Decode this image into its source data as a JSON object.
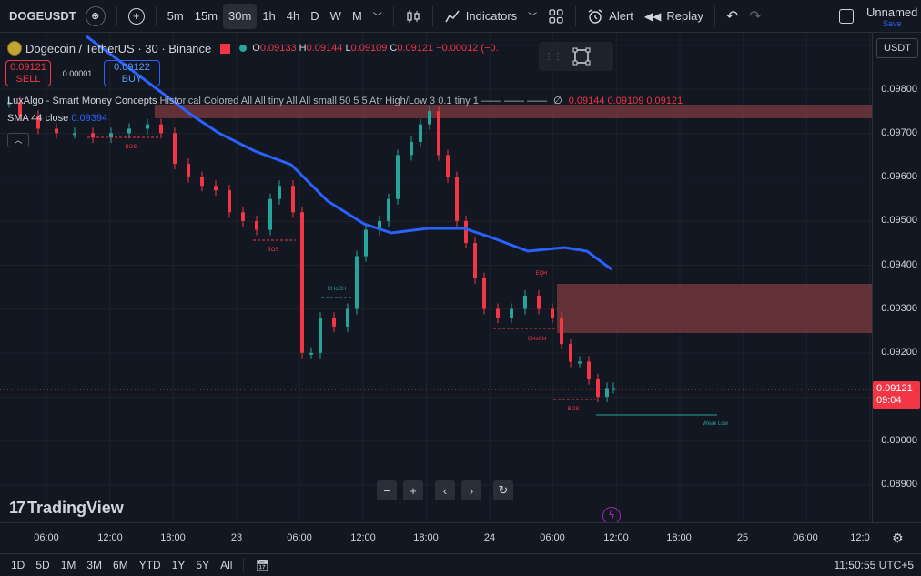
{
  "toolbar": {
    "symbol": "DOGEUSDT",
    "intervals": [
      "5m",
      "15m",
      "30m",
      "1h",
      "4h",
      "D",
      "W",
      "M"
    ],
    "active_interval": "30m",
    "indicators_label": "Indicators",
    "alert_label": "Alert",
    "replay_label": "Replay",
    "workspace_name": "Unnamed",
    "workspace_status": "Save"
  },
  "legend": {
    "title": "Dogecoin / TetherUS · 30 · Binance",
    "o_label": "O",
    "o": "0.09133",
    "h_label": "H",
    "h": "0.09144",
    "l_label": "L",
    "l": "0.09109",
    "c_label": "C",
    "c": "0.09121",
    "change": "−0.00012 (−0.",
    "sell_price": "0.09121",
    "sell_label": "SELL",
    "spread": "0.00001",
    "buy_price": "0.09122",
    "buy_label": "BUY",
    "smc_name": "LuxAlgo - Smart Money Concepts",
    "smc_params": "Historical Colored All All tiny All All small 50 5 5 Atr High/Low 3 0.1 tiny 1 —— —— ——",
    "smc_values": "0.09144  0.09109  0.09121",
    "sma_name": "SMA 44 close",
    "sma_value": "0.09394"
  },
  "price_axis": {
    "currency": "USDT",
    "labels": [
      "0.09800",
      "0.09700",
      "0.09600",
      "0.09500",
      "0.09400",
      "0.09300",
      "0.09200",
      "0.09000",
      "0.08900"
    ],
    "current_price": "0.09121",
    "countdown": "09:04"
  },
  "time_axis": {
    "labels": [
      "06:00",
      "12:00",
      "18:00",
      "23",
      "06:00",
      "12:00",
      "18:00",
      "24",
      "06:00",
      "12:00",
      "18:00",
      "25",
      "06:00",
      "12:0"
    ]
  },
  "annotations": {
    "bos": "BOS",
    "choch": "CHoCH",
    "eqh": "EQH",
    "weak_low": "Weak Low"
  },
  "bottom_bar": {
    "ranges": [
      "1D",
      "5D",
      "1M",
      "3M",
      "6M",
      "YTD",
      "1Y",
      "5Y",
      "All"
    ],
    "clock": "11:50:55 UTC+5"
  },
  "brand": "TradingView",
  "colors": {
    "bg": "#131722",
    "up": "#26a69a",
    "down": "#f23645",
    "sma": "#2962ff",
    "zone": "#7d3a3f"
  }
}
